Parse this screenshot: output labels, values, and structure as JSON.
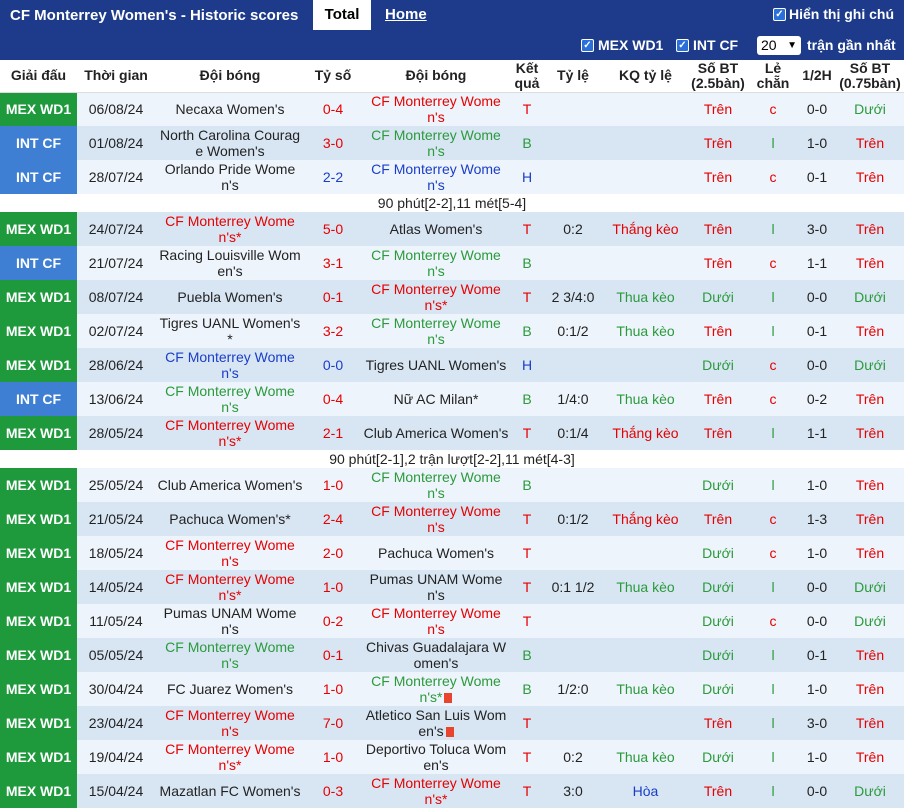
{
  "header": {
    "title": "CF Monterrey Women's - Historic scores",
    "tab_total": "Total",
    "tab_home": "Home",
    "show_tip": "Hiển thị ghi chú"
  },
  "filters": {
    "league1": "MEX WD1",
    "league2": "INT CF",
    "count": "20",
    "recent": "trận gần nhất"
  },
  "columns": [
    "Giải đấu",
    "Thời gian",
    "Đội bóng",
    "Tỷ số",
    "Đội bóng",
    "Kết quả",
    "Tỷ lệ",
    "KQ tỷ lệ",
    "Số BT (2.5bàn)",
    "Lẻ chẵn",
    "1/2H",
    "Số BT (0.75bàn)"
  ],
  "colors": {
    "win": "#e60000",
    "draw": "#1a3dc8",
    "loss": "#2a9a3b",
    "mex": "#1e9a3c",
    "int": "#3e7fd3"
  },
  "rows": [
    {
      "league": "MEX WD1",
      "date": "06/08/24",
      "home": "Necaxa Women's",
      "hc": "",
      "score": "0-4",
      "sc": "red",
      "away": "CF Monterrey Women's",
      "ac": "red",
      "res": "T",
      "rc": "red",
      "hcp": "",
      "hr": "",
      "hrc": "",
      "ou": "Trên",
      "ouc": "red",
      "oe": "c",
      "oec": "red",
      "half": "0-0",
      "ou2": "Dưới",
      "ou2c": "green"
    },
    {
      "league": "INT CF",
      "date": "01/08/24",
      "home": "North Carolina Courage Women's",
      "hc": "",
      "score": "3-0",
      "sc": "red",
      "away": "CF Monterrey Women's",
      "ac": "green",
      "res": "B",
      "rc": "green",
      "hcp": "",
      "hr": "",
      "hrc": "",
      "ou": "Trên",
      "ouc": "red",
      "oe": "l",
      "oec": "green",
      "half": "1-0",
      "ou2": "Trên",
      "ou2c": "red"
    },
    {
      "league": "INT CF",
      "date": "28/07/24",
      "home": "Orlando Pride Women's",
      "hc": "",
      "score": "2-2",
      "sc": "blue",
      "away": "CF Monterrey Women's",
      "ac": "blue",
      "res": "H",
      "rc": "blue",
      "hcp": "",
      "hr": "",
      "hrc": "",
      "ou": "Trên",
      "ouc": "red",
      "oe": "c",
      "oec": "red",
      "half": "0-1",
      "ou2": "Trên",
      "ou2c": "red",
      "note": "90 phút[2-2],11 mét[5-4]"
    },
    {
      "league": "MEX WD1",
      "date": "24/07/24",
      "home": "CF Monterrey Women's*",
      "hc": "red",
      "score": "5-0",
      "sc": "red",
      "away": "Atlas Women's",
      "ac": "",
      "res": "T",
      "rc": "red",
      "hcp": "0:2",
      "hr": "Thắng kèo",
      "hrc": "red",
      "ou": "Trên",
      "ouc": "red",
      "oe": "l",
      "oec": "green",
      "half": "3-0",
      "ou2": "Trên",
      "ou2c": "red"
    },
    {
      "league": "INT CF",
      "date": "21/07/24",
      "home": "Racing Louisville Women's",
      "hc": "",
      "score": "3-1",
      "sc": "red",
      "away": "CF Monterrey Women's",
      "ac": "green",
      "res": "B",
      "rc": "green",
      "hcp": "",
      "hr": "",
      "hrc": "",
      "ou": "Trên",
      "ouc": "red",
      "oe": "c",
      "oec": "red",
      "half": "1-1",
      "ou2": "Trên",
      "ou2c": "red"
    },
    {
      "league": "MEX WD1",
      "date": "08/07/24",
      "home": "Puebla Women's",
      "hc": "",
      "score": "0-1",
      "sc": "red",
      "away": "CF Monterrey Women's*",
      "ac": "red",
      "res": "T",
      "rc": "red",
      "hcp": "2 3/4:0",
      "hr": "Thua kèo",
      "hrc": "green",
      "ou": "Dưới",
      "ouc": "green",
      "oe": "l",
      "oec": "green",
      "half": "0-0",
      "ou2": "Dưới",
      "ou2c": "green"
    },
    {
      "league": "MEX WD1",
      "date": "02/07/24",
      "home": "Tigres UANL Women's*",
      "hc": "",
      "score": "3-2",
      "sc": "red",
      "away": "CF Monterrey Women's",
      "ac": "green",
      "res": "B",
      "rc": "green",
      "hcp": "0:1/2",
      "hr": "Thua kèo",
      "hrc": "green",
      "ou": "Trên",
      "ouc": "red",
      "oe": "l",
      "oec": "green",
      "half": "0-1",
      "ou2": "Trên",
      "ou2c": "red"
    },
    {
      "league": "MEX WD1",
      "date": "28/06/24",
      "home": "CF Monterrey Women's",
      "hc": "blue",
      "score": "0-0",
      "sc": "blue",
      "away": "Tigres UANL Women's",
      "ac": "",
      "res": "H",
      "rc": "blue",
      "hcp": "",
      "hr": "",
      "hrc": "",
      "ou": "Dưới",
      "ouc": "green",
      "oe": "c",
      "oec": "red",
      "half": "0-0",
      "ou2": "Dưới",
      "ou2c": "green"
    },
    {
      "league": "INT CF",
      "date": "13/06/24",
      "home": "CF Monterrey Women's",
      "hc": "green",
      "score": "0-4",
      "sc": "red",
      "away": "Nữ AC Milan*",
      "ac": "",
      "res": "B",
      "rc": "green",
      "hcp": "1/4:0",
      "hr": "Thua kèo",
      "hrc": "green",
      "ou": "Trên",
      "ouc": "red",
      "oe": "c",
      "oec": "red",
      "half": "0-2",
      "ou2": "Trên",
      "ou2c": "red"
    },
    {
      "league": "MEX WD1",
      "date": "28/05/24",
      "home": "CF Monterrey Women's*",
      "hc": "red",
      "score": "2-1",
      "sc": "red",
      "away": "Club America Women's",
      "ac": "",
      "res": "T",
      "rc": "red",
      "hcp": "0:1/4",
      "hr": "Thắng kèo",
      "hrc": "red",
      "ou": "Trên",
      "ouc": "red",
      "oe": "l",
      "oec": "green",
      "half": "1-1",
      "ou2": "Trên",
      "ou2c": "red",
      "note": "90 phút[2-1],2 trận lượt[2-2],11 mét[4-3]"
    },
    {
      "league": "MEX WD1",
      "date": "25/05/24",
      "home": "Club America Women's",
      "hc": "",
      "score": "1-0",
      "sc": "red",
      "away": "CF Monterrey Women's",
      "ac": "green",
      "res": "B",
      "rc": "green",
      "hcp": "",
      "hr": "",
      "hrc": "",
      "ou": "Dưới",
      "ouc": "green",
      "oe": "l",
      "oec": "green",
      "half": "1-0",
      "ou2": "Trên",
      "ou2c": "red"
    },
    {
      "league": "MEX WD1",
      "date": "21/05/24",
      "home": "Pachuca Women's*",
      "hc": "",
      "score": "2-4",
      "sc": "red",
      "away": "CF Monterrey Women's",
      "ac": "red",
      "res": "T",
      "rc": "red",
      "hcp": "0:1/2",
      "hr": "Thắng kèo",
      "hrc": "red",
      "ou": "Trên",
      "ouc": "red",
      "oe": "c",
      "oec": "red",
      "half": "1-3",
      "ou2": "Trên",
      "ou2c": "red"
    },
    {
      "league": "MEX WD1",
      "date": "18/05/24",
      "home": "CF Monterrey Women's",
      "hc": "red",
      "score": "2-0",
      "sc": "red",
      "away": "Pachuca Women's",
      "ac": "",
      "res": "T",
      "rc": "red",
      "hcp": "",
      "hr": "",
      "hrc": "",
      "ou": "Dưới",
      "ouc": "green",
      "oe": "c",
      "oec": "red",
      "half": "1-0",
      "ou2": "Trên",
      "ou2c": "red"
    },
    {
      "league": "MEX WD1",
      "date": "14/05/24",
      "home": "CF Monterrey Women's*",
      "hc": "red",
      "score": "1-0",
      "sc": "red",
      "away": "Pumas UNAM Women's",
      "ac": "",
      "res": "T",
      "rc": "red",
      "hcp": "0:1 1/2",
      "hr": "Thua kèo",
      "hrc": "green",
      "ou": "Dưới",
      "ouc": "green",
      "oe": "l",
      "oec": "green",
      "half": "0-0",
      "ou2": "Dưới",
      "ou2c": "green"
    },
    {
      "league": "MEX WD1",
      "date": "11/05/24",
      "home": "Pumas UNAM Women's",
      "hc": "",
      "score": "0-2",
      "sc": "red",
      "away": "CF Monterrey Women's",
      "ac": "red",
      "res": "T",
      "rc": "red",
      "hcp": "",
      "hr": "",
      "hrc": "",
      "ou": "Dưới",
      "ouc": "green",
      "oe": "c",
      "oec": "red",
      "half": "0-0",
      "ou2": "Dưới",
      "ou2c": "green"
    },
    {
      "league": "MEX WD1",
      "date": "05/05/24",
      "home": "CF Monterrey Women's",
      "hc": "green",
      "score": "0-1",
      "sc": "red",
      "away": "Chivas Guadalajara Women's",
      "ac": "",
      "res": "B",
      "rc": "green",
      "hcp": "",
      "hr": "",
      "hrc": "",
      "ou": "Dưới",
      "ouc": "green",
      "oe": "l",
      "oec": "green",
      "half": "0-1",
      "ou2": "Trên",
      "ou2c": "red"
    },
    {
      "league": "MEX WD1",
      "date": "30/04/24",
      "home": "FC Juarez Women's",
      "hc": "",
      "score": "1-0",
      "sc": "red",
      "away": "CF Monterrey Women's*",
      "ac": "green",
      "acard": true,
      "res": "B",
      "rc": "green",
      "hcp": "1/2:0",
      "hr": "Thua kèo",
      "hrc": "green",
      "ou": "Dưới",
      "ouc": "green",
      "oe": "l",
      "oec": "green",
      "half": "1-0",
      "ou2": "Trên",
      "ou2c": "red"
    },
    {
      "league": "MEX WD1",
      "date": "23/04/24",
      "home": "CF Monterrey Women's",
      "hc": "red",
      "score": "7-0",
      "sc": "red",
      "away": "Atletico San Luis Women's",
      "ac": "",
      "acard": true,
      "res": "T",
      "rc": "red",
      "hcp": "",
      "hr": "",
      "hrc": "",
      "ou": "Trên",
      "ouc": "red",
      "oe": "l",
      "oec": "green",
      "half": "3-0",
      "ou2": "Trên",
      "ou2c": "red"
    },
    {
      "league": "MEX WD1",
      "date": "19/04/24",
      "home": "CF Monterrey Women's*",
      "hc": "red",
      "score": "1-0",
      "sc": "red",
      "away": "Deportivo Toluca Women's",
      "ac": "",
      "res": "T",
      "rc": "red",
      "hcp": "0:2",
      "hr": "Thua kèo",
      "hrc": "green",
      "ou": "Dưới",
      "ouc": "green",
      "oe": "l",
      "oec": "green",
      "half": "1-0",
      "ou2": "Trên",
      "ou2c": "red"
    },
    {
      "league": "MEX WD1",
      "date": "15/04/24",
      "home": "Mazatlan FC Women's",
      "hc": "",
      "score": "0-3",
      "sc": "red",
      "away": "CF Monterrey Women's*",
      "ac": "red",
      "res": "T",
      "rc": "red",
      "hcp": "3:0",
      "hr": "Hòa",
      "hrc": "blue",
      "ou": "Trên",
      "ouc": "red",
      "oe": "l",
      "oec": "green",
      "half": "0-0",
      "ou2": "Dưới",
      "ou2c": "green"
    }
  ]
}
